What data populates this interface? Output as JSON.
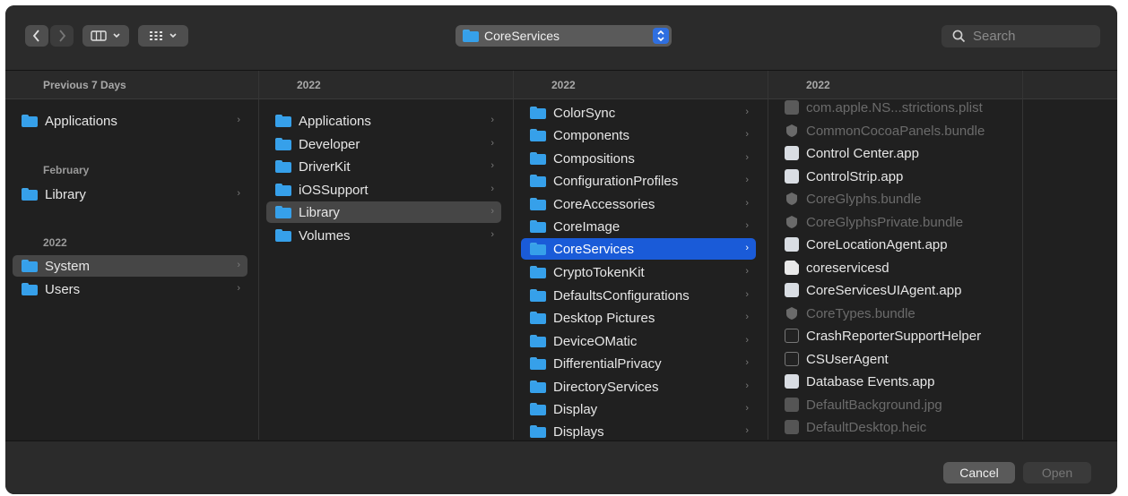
{
  "toolbar": {
    "path_popup": "CoreServices",
    "search_placeholder": "Search"
  },
  "columns": [
    {
      "header": "Previous 7 Days",
      "sections": [
        "February",
        "2022"
      ],
      "items": [
        {
          "name": "Applications",
          "icon": "folder-icon"
        },
        {
          "name": "Library",
          "icon": "folder-icon"
        },
        {
          "name": "System",
          "icon": "folder-icon",
          "state": "selected"
        },
        {
          "name": "Users",
          "icon": "folder-icon"
        }
      ]
    },
    {
      "header": "2022",
      "items": [
        {
          "name": "Applications"
        },
        {
          "name": "Developer"
        },
        {
          "name": "DriverKit"
        },
        {
          "name": "iOSSupport"
        },
        {
          "name": "Library",
          "state": "selected"
        },
        {
          "name": "Volumes"
        }
      ]
    },
    {
      "header": "2022",
      "items": [
        {
          "name": "ColorSync"
        },
        {
          "name": "Components"
        },
        {
          "name": "Compositions"
        },
        {
          "name": "ConfigurationProfiles"
        },
        {
          "name": "CoreAccessories"
        },
        {
          "name": "CoreImage"
        },
        {
          "name": "CoreServices",
          "state": "active"
        },
        {
          "name": "CryptoTokenKit"
        },
        {
          "name": "DefaultsConfigurations"
        },
        {
          "name": "Desktop Pictures"
        },
        {
          "name": "DeviceOMatic"
        },
        {
          "name": "DifferentialPrivacy"
        },
        {
          "name": "DirectoryServices"
        },
        {
          "name": "Display"
        },
        {
          "name": "Displays"
        }
      ]
    },
    {
      "header": "2022",
      "items": [
        {
          "name": "com.apple.NS...strictions.plist",
          "icon": "document-icon",
          "dim": true
        },
        {
          "name": "CommonCocoaPanels.bundle",
          "icon": "bundle-icon",
          "dim": true
        },
        {
          "name": "Control Center.app",
          "icon": "app-icon"
        },
        {
          "name": "ControlStrip.app",
          "icon": "app-icon"
        },
        {
          "name": "CoreGlyphs.bundle",
          "icon": "bundle-icon",
          "dim": true
        },
        {
          "name": "CoreGlyphsPrivate.bundle",
          "icon": "bundle-icon",
          "dim": true
        },
        {
          "name": "CoreLocationAgent.app",
          "icon": "app-icon"
        },
        {
          "name": "coreservicesd",
          "icon": "document-icon"
        },
        {
          "name": "CoreServicesUIAgent.app",
          "icon": "app-icon"
        },
        {
          "name": "CoreTypes.bundle",
          "icon": "bundle-icon",
          "dim": true
        },
        {
          "name": "CrashReporterSupportHelper",
          "icon": "terminal-icon"
        },
        {
          "name": "CSUserAgent",
          "icon": "terminal-icon"
        },
        {
          "name": "Database Events.app",
          "icon": "app-icon"
        },
        {
          "name": "DefaultBackground.jpg",
          "icon": "image-icon",
          "dim": true
        },
        {
          "name": "DefaultDesktop.heic",
          "icon": "image-icon",
          "dim": true
        }
      ]
    }
  ],
  "footer": {
    "cancel": "Cancel",
    "open": "Open"
  }
}
